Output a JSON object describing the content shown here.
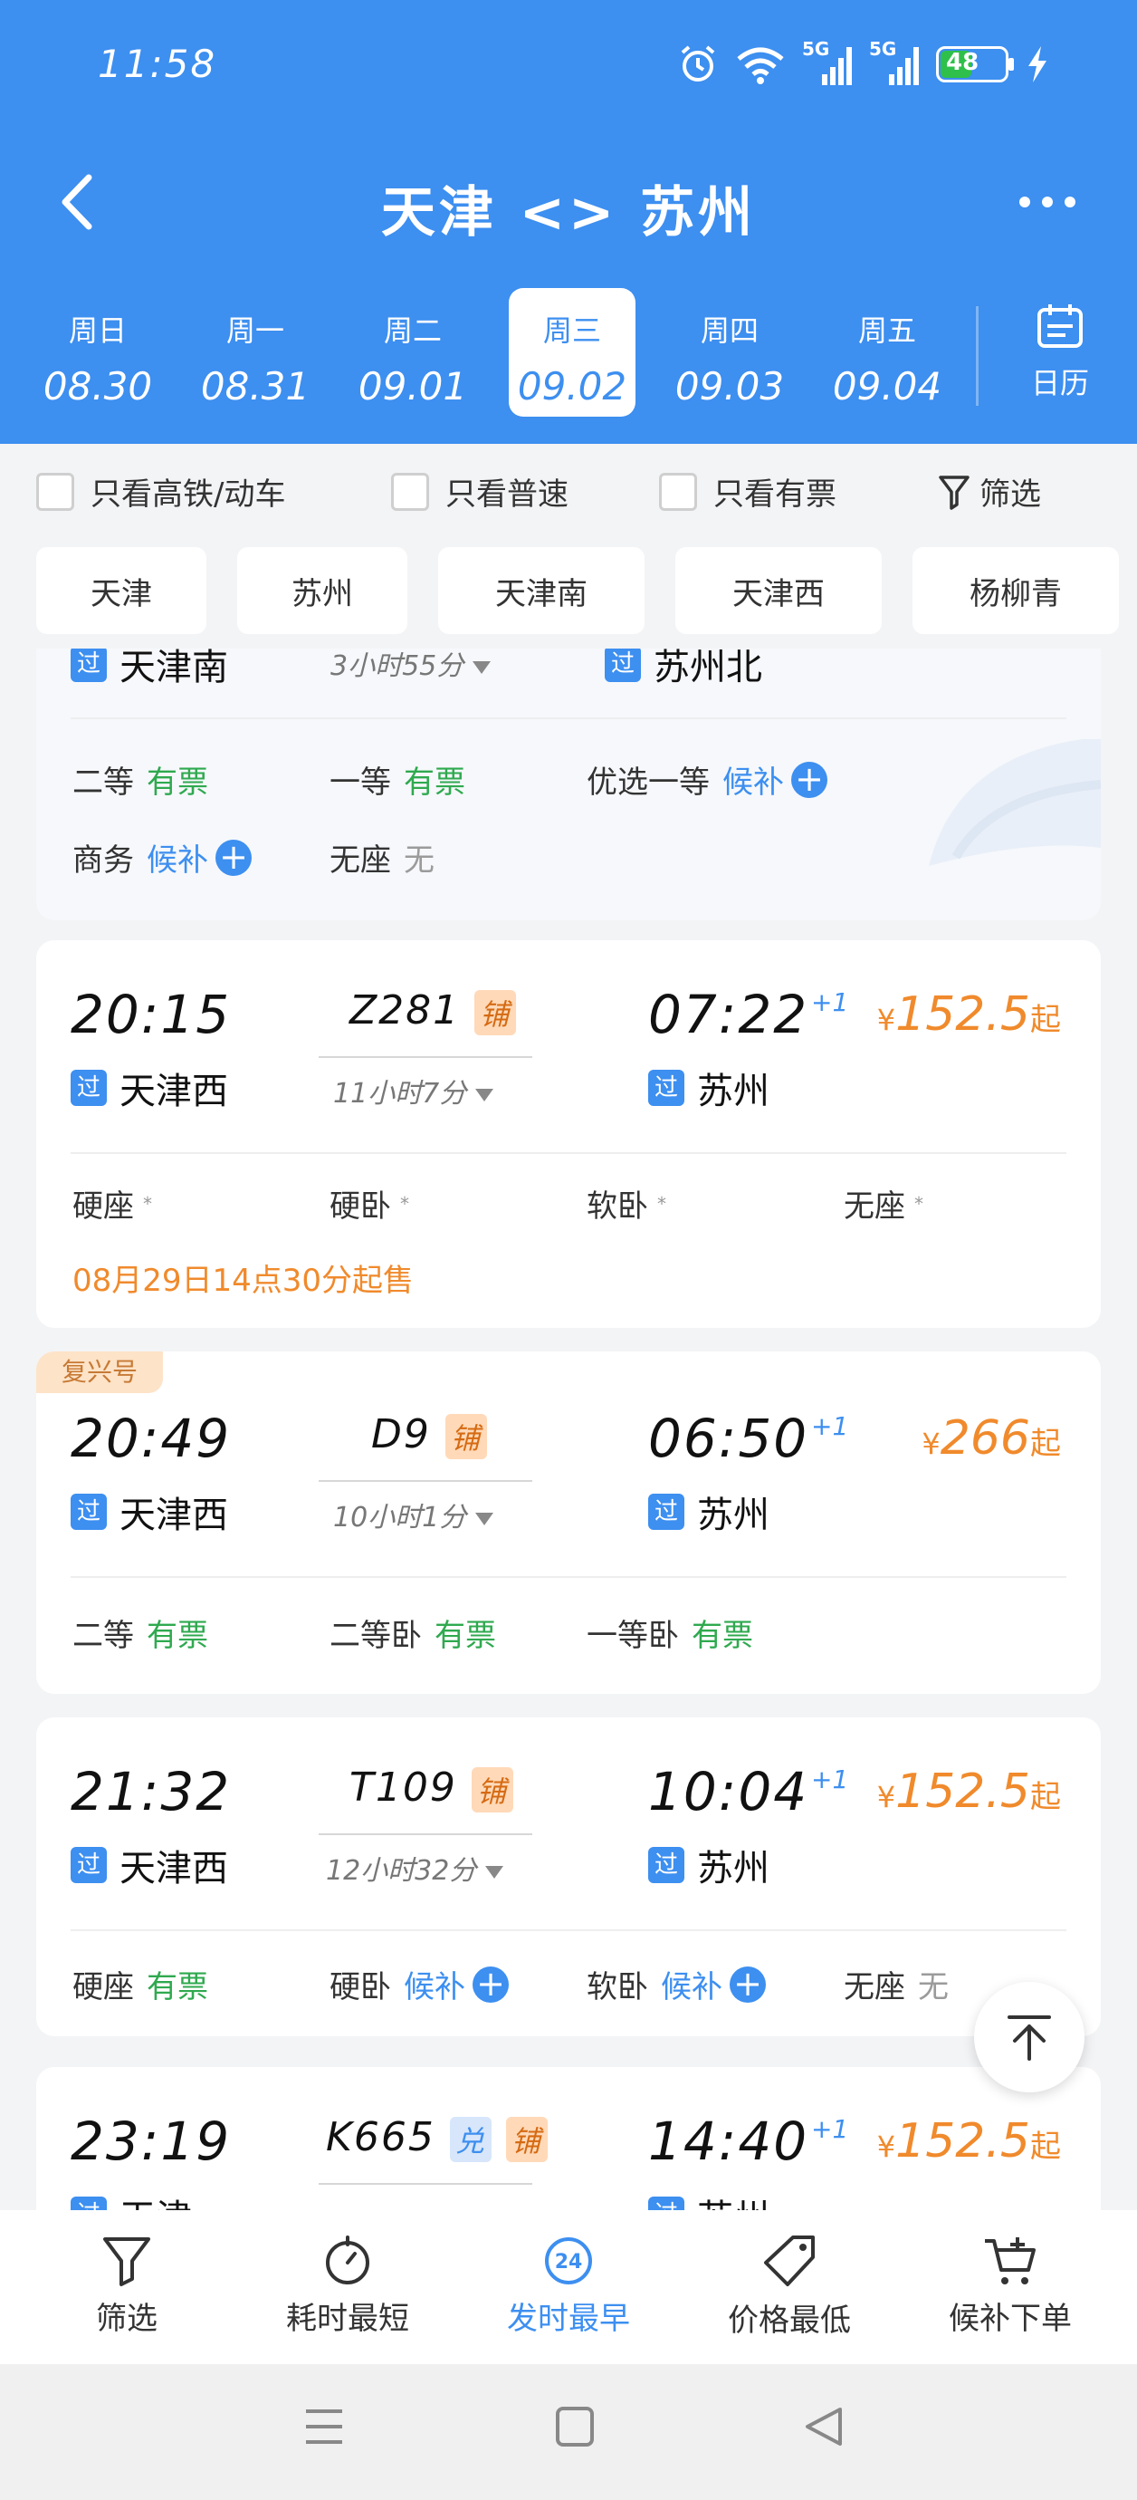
{
  "status": {
    "time": "11:58",
    "net1": "5G",
    "net2": "5G",
    "battery": "48"
  },
  "header": {
    "title": "天津 <> 苏州"
  },
  "dates": [
    {
      "weekday": "周日",
      "date": "08.30"
    },
    {
      "weekday": "周一",
      "date": "08.31"
    },
    {
      "weekday": "周二",
      "date": "09.01"
    },
    {
      "weekday": "周三",
      "date": "09.02",
      "selected": true
    },
    {
      "weekday": "周四",
      "date": "09.03"
    },
    {
      "weekday": "周五",
      "date": "09.04"
    }
  ],
  "calendar_label": "日历",
  "filters": {
    "high_speed": "只看高铁/动车",
    "normal": "只看普速",
    "available": "只看有票",
    "filter": "筛选"
  },
  "stations": [
    "天津",
    "苏州",
    "天津南",
    "天津西",
    "杨柳青"
  ],
  "card0": {
    "dep_tag": "过",
    "dep_station": "天津南",
    "duration": "3小时55分",
    "arr_tag": "过",
    "arr_station": "苏州北",
    "seats": {
      "s1_name": "二等",
      "s1_status": "有票",
      "s2_name": "一等",
      "s2_status": "有票",
      "s3_name": "优选一等",
      "s3_status": "候补",
      "s4_name": "商务",
      "s4_status": "候补",
      "s5_name": "无座",
      "s5_status": "无"
    }
  },
  "card1": {
    "dep_time": "20:15",
    "train": "Z281",
    "tag_pu": "铺",
    "arr_time": "07:22",
    "plus": "+1",
    "price_cur": "¥",
    "price": "152.5",
    "price_qi": "起",
    "dep_tag": "过",
    "dep_station": "天津西",
    "duration": "11小时7分",
    "arr_tag": "过",
    "arr_station": "苏州",
    "seats": {
      "s1_name": "硬座",
      "s2_name": "硬卧",
      "s3_name": "软卧",
      "s4_name": "无座",
      "star": "*"
    },
    "sale_note": "08月29日14点30分起售"
  },
  "card2": {
    "badge": "复兴号",
    "dep_time": "20:49",
    "train": "D9",
    "tag_pu": "铺",
    "arr_time": "06:50",
    "plus": "+1",
    "price_cur": "¥",
    "price": "266",
    "price_qi": "起",
    "dep_tag": "过",
    "dep_station": "天津西",
    "duration": "10小时1分",
    "arr_tag": "过",
    "arr_station": "苏州",
    "seats": {
      "s1_name": "二等",
      "s1_status": "有票",
      "s2_name": "二等卧",
      "s2_status": "有票",
      "s3_name": "一等卧",
      "s3_status": "有票"
    }
  },
  "card3": {
    "dep_time": "21:32",
    "train": "T109",
    "tag_pu": "铺",
    "arr_time": "10:04",
    "plus": "+1",
    "price_cur": "¥",
    "price": "152.5",
    "price_qi": "起",
    "dep_tag": "过",
    "dep_station": "天津西",
    "duration": "12小时32分",
    "arr_tag": "过",
    "arr_station": "苏州",
    "seats": {
      "s1_name": "硬座",
      "s1_status": "有票",
      "s2_name": "硬卧",
      "s2_status": "候补",
      "s3_name": "软卧",
      "s3_status": "候补",
      "s4_name": "无座",
      "s4_status": "无"
    }
  },
  "card4": {
    "dep_time": "23:19",
    "train": "K665",
    "tag_dui": "兑",
    "tag_pu": "铺",
    "arr_time": "14:40",
    "plus": "+1",
    "price_cur": "¥",
    "price": "152.5",
    "price_qi": "起",
    "dep_tag": "过",
    "dep_station": "天津",
    "arr_tag": "过",
    "arr_station": "苏州"
  },
  "bottom_nav": {
    "filter": "筛选",
    "shortest": "耗时最短",
    "earliest": "发时最早",
    "cheapest": "价格最低",
    "waitlist": "候补下单",
    "earliest_icon_num": "24"
  },
  "colors": {
    "primary": "#3d8ff0",
    "price": "#f08a2c",
    "available": "#2fa94f",
    "none": "#9b9b9b"
  }
}
